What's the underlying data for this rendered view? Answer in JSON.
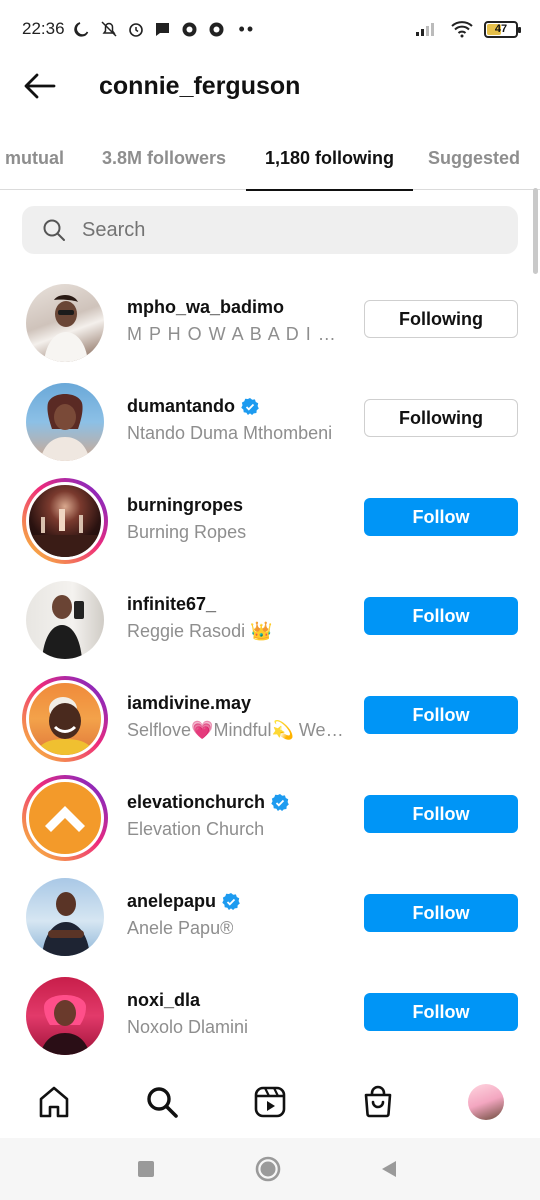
{
  "status_bar": {
    "time": "22:36",
    "icons": [
      "moon-icon",
      "mute-icon",
      "alarm-icon",
      "message-icon",
      "chrome-icon",
      "chrome-icon"
    ],
    "dots": "••",
    "battery": "47"
  },
  "header": {
    "back_icon": "arrow-left-icon",
    "title": "connie_ferguson"
  },
  "tabs": [
    {
      "label": "mutual",
      "active": false
    },
    {
      "label": "3.8M followers",
      "active": false
    },
    {
      "label": "1,180 following",
      "active": true
    },
    {
      "label": "Suggested",
      "active": false
    }
  ],
  "search": {
    "placeholder": "Search"
  },
  "accounts": [
    {
      "username": "mpho_wa_badimo",
      "fullname": "M P H O W A B A D I M O",
      "verified": false,
      "button": "Following",
      "ring": false
    },
    {
      "username": "dumantando",
      "fullname": "Ntando Duma Mthombeni",
      "verified": true,
      "button": "Following",
      "ring": false
    },
    {
      "username": "burningropes",
      "fullname": "Burning Ropes",
      "verified": false,
      "button": "Follow",
      "ring": true
    },
    {
      "username": "infinite67_",
      "fullname": "Reggie Rasodi 👑",
      "verified": false,
      "button": "Follow",
      "ring": false
    },
    {
      "username": "iamdivine.may",
      "fullname": "Selflove💗Mindful💫 Wellness",
      "verified": false,
      "button": "Follow",
      "ring": true
    },
    {
      "username": "elevationchurch",
      "fullname": "Elevation Church",
      "verified": true,
      "button": "Follow",
      "ring": true
    },
    {
      "username": "anelepapu",
      "fullname": "Anele Papu®",
      "verified": true,
      "button": "Follow",
      "ring": false
    },
    {
      "username": "noxi_dla",
      "fullname": "Noxolo Dlamini",
      "verified": false,
      "button": "Follow",
      "ring": false
    }
  ],
  "bottom_nav": [
    "home-icon",
    "search-icon",
    "reels-icon",
    "shop-icon",
    "profile-avatar"
  ],
  "system_nav": [
    "recents-icon",
    "home-circle-icon",
    "back-triangle-icon"
  ],
  "colors": {
    "accent": "#0095f6",
    "verified": "#1d9bf0",
    "muted_text": "#8e8e8e",
    "search_bg": "#efefef"
  }
}
